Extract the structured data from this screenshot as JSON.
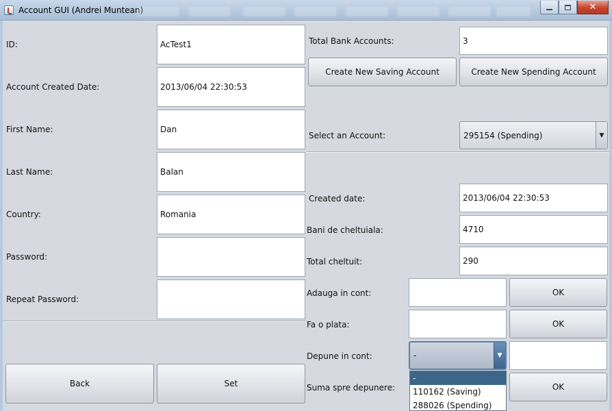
{
  "window": {
    "title": "Account GUI (Andrei Muntean)",
    "controls": {
      "minimize_icon": "minimize-icon",
      "maximize_icon": "maximize-icon",
      "close_glyph": "✕"
    }
  },
  "left_form": {
    "fields": [
      {
        "label": "ID:",
        "value": "AcTest1"
      },
      {
        "label": "Account Created Date:",
        "value": "2013/06/04 22:30:53"
      },
      {
        "label": "First Name:",
        "value": "Dan"
      },
      {
        "label": "Last Name:",
        "value": "Balan"
      },
      {
        "label": "Country:",
        "value": "Romania"
      },
      {
        "label": "Password:",
        "value": ""
      },
      {
        "label": "Repeat Password:",
        "value": ""
      }
    ],
    "back_label": "Back",
    "set_label": "Set"
  },
  "right_panel": {
    "total_accounts_label": "Total Bank Accounts:",
    "total_accounts_value": "3",
    "create_saving_label": "Create New Saving Account",
    "create_spending_label": "Create New Spending Account",
    "select_account_label": "Select an Account:",
    "select_account_value": "295154 (Spending)",
    "created_date_label": "Created date:",
    "created_date_value": "2013/06/04 22:30:53",
    "spending_money_label": "Bani de cheltuiala:",
    "spending_money_value": "4710",
    "total_spent_label": "Total cheltuit:",
    "total_spent_value": "290",
    "add_to_account_label": "Adauga in cont:",
    "add_to_account_value": "",
    "make_payment_label": "Fa o plata:",
    "make_payment_value": "",
    "deposit_label": "Depune in cont:",
    "deposit_selected": "-",
    "deposit_amount_label": "Suma spre depunere:",
    "ok_label": "OK",
    "deposit_options": [
      "-",
      "110162 (Saving)",
      "288026 (Spending)"
    ]
  }
}
